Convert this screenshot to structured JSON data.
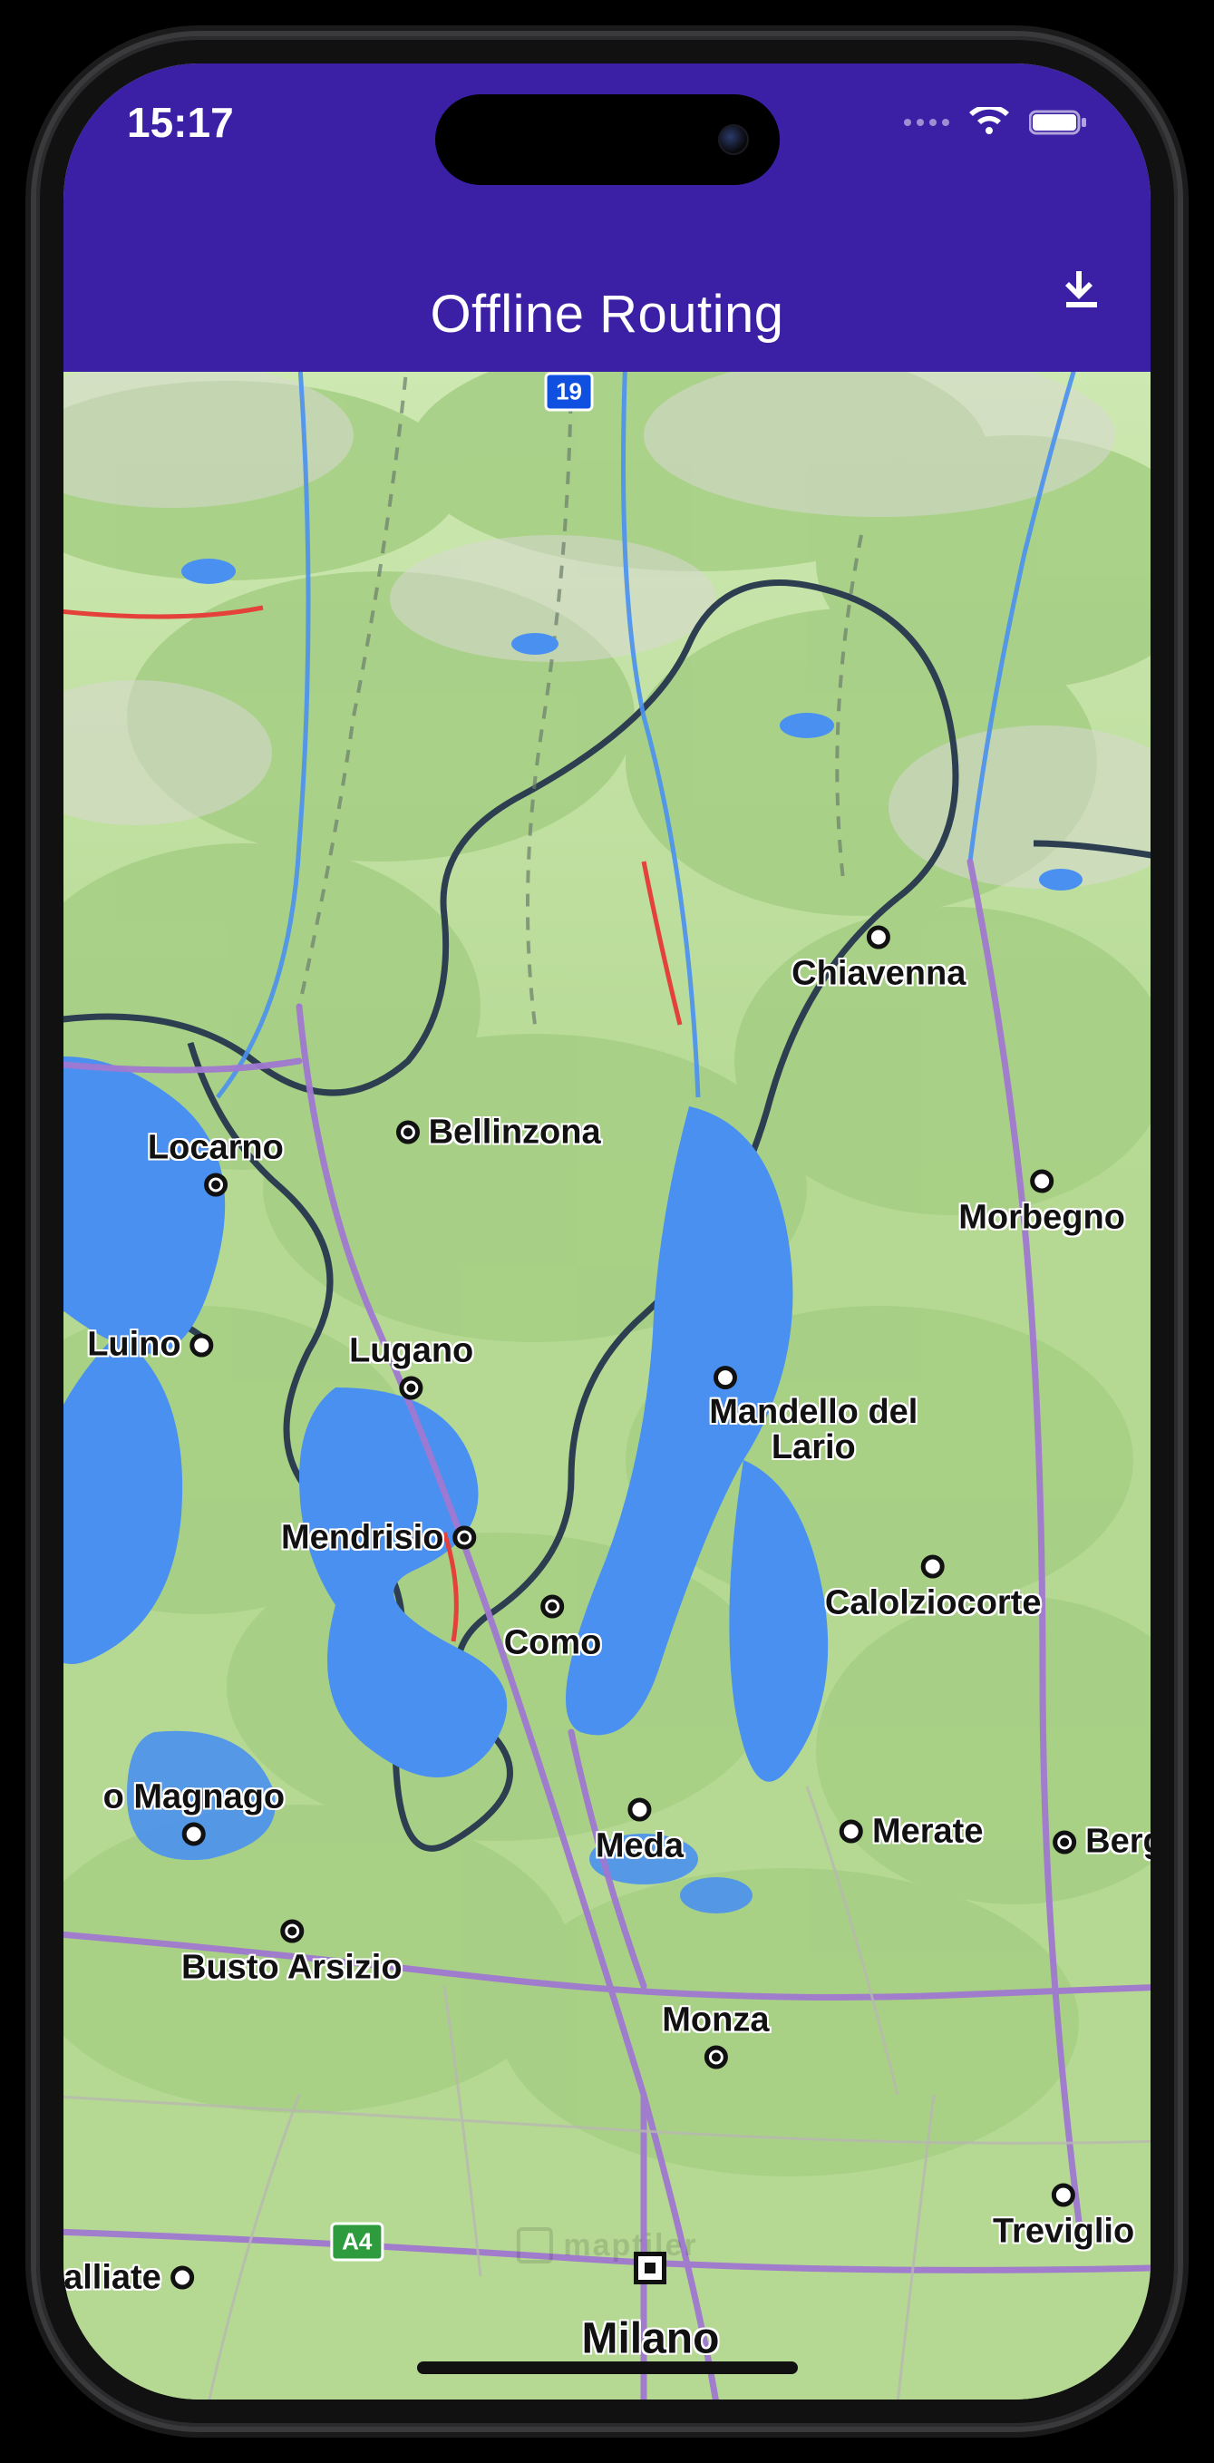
{
  "status": {
    "time": "15:17"
  },
  "appbar": {
    "title": "Offline Routing"
  },
  "shields": {
    "s19": "19",
    "a4": "A4"
  },
  "cities": {
    "chiavenna": "Chiavenna",
    "bellinzona": "Bellinzona",
    "locarno": "Locarno",
    "morbegno": "Morbegno",
    "luino": "Luino",
    "lugano": "Lugano",
    "mandello": "Mandello del\nLario",
    "mendrisio": "Mendrisio",
    "calolziocorte": "Calolziocorte",
    "como": "Como",
    "magnago": "o Magnago",
    "meda": "Meda",
    "merate": "Merate",
    "berga": "Berga",
    "busto": "Busto Arsizio",
    "monza": "Monza",
    "treviglio": "Treviglio",
    "alliate": "alliate",
    "milano": "Milano"
  },
  "watermark": "maptiler"
}
